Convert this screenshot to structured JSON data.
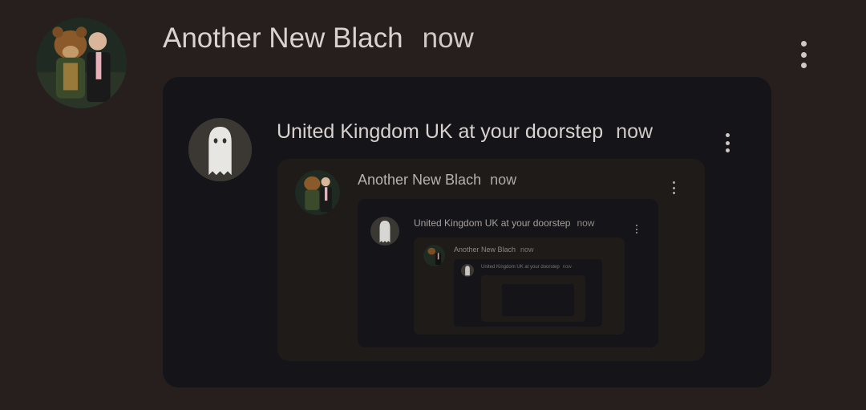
{
  "post": {
    "author": "Another New Blach",
    "time": "now"
  },
  "shared": {
    "author": "United Kingdom UK at your doorstep",
    "time": "now"
  },
  "nested": {
    "author": "Another New Blach",
    "time": "now"
  },
  "nested2": {
    "author": "United Kingdom UK at your doorstep",
    "time": "now"
  },
  "nested3": {
    "author": "Another New Blach",
    "time": "now"
  },
  "nested4": {
    "author": "United Kingdom UK at your doorstep",
    "time": "now"
  },
  "icons": {
    "author_avatar": "bear-and-man-photo",
    "shared_avatar": "ghost-photo",
    "menu": "more-vertical-icon"
  }
}
